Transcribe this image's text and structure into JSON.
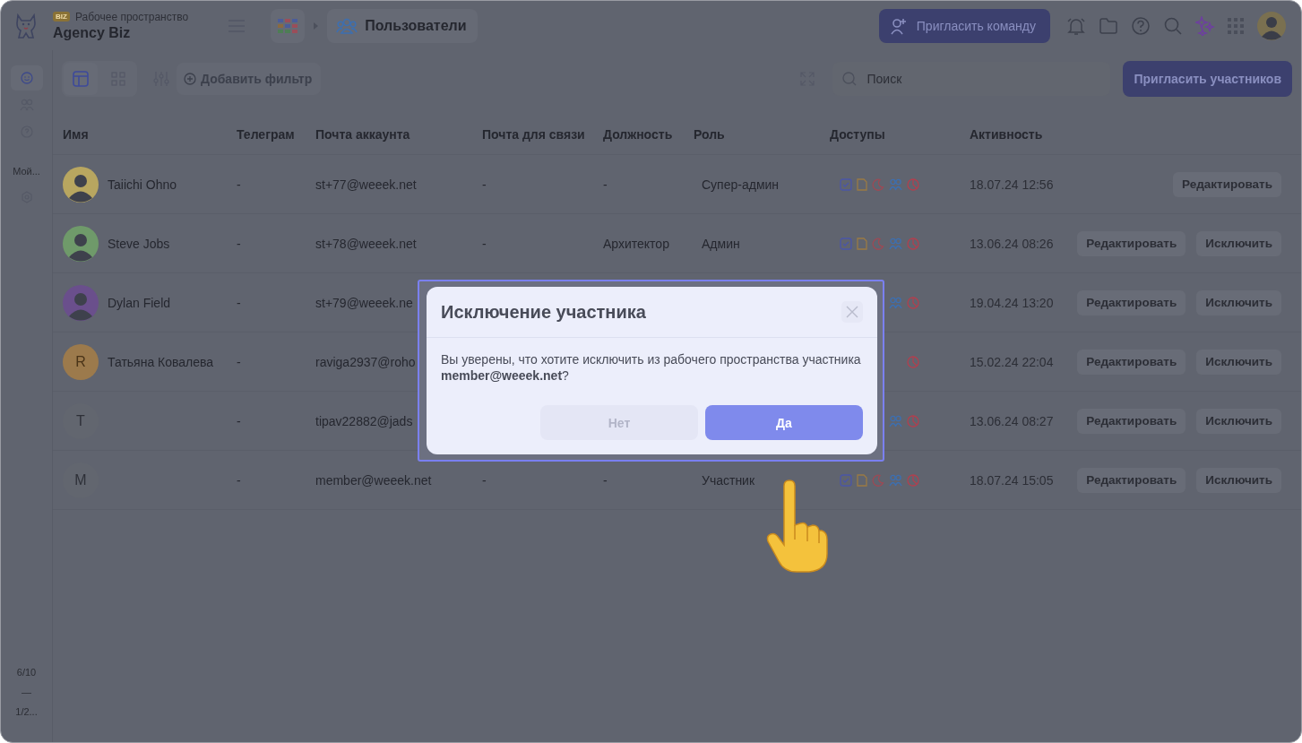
{
  "workspace": {
    "badge": "BIZ",
    "label": "Рабочее пространство",
    "name": "Agency Biz"
  },
  "breadcrumb": {
    "page": "Пользователи"
  },
  "header": {
    "invite_button": "Пригласить команду"
  },
  "sidebar": {
    "icons": [
      {
        "selected": true
      },
      {
        "selected": false
      },
      {
        "selected": false
      }
    ],
    "section_label": "Мой...",
    "footer": [
      "6/10",
      "—",
      "1/2..."
    ]
  },
  "toolbar": {
    "views": [
      {
        "selected": true
      },
      {
        "selected": false
      }
    ],
    "filter_button": "Добавить фильтр",
    "search_placeholder": "Поиск",
    "invite_button": "Пригласить участников"
  },
  "table": {
    "columns": [
      "Имя",
      "Телеграм",
      "Почта аккаунта",
      "Почта для связи",
      "Должность",
      "Роль",
      "Доступы",
      "Активность"
    ],
    "rows": [
      {
        "name": "Taiichi Ohno",
        "avatar": {
          "kind": "photo",
          "color": "#b8a660"
        },
        "telegram": "-",
        "account_email": "st+77@weeek.net",
        "contact_email": "-",
        "position": "-",
        "role": "Супер-админ",
        "access": [
          {
            "kind": "task"
          },
          {
            "kind": "doc"
          },
          {
            "kind": "moon"
          },
          {
            "kind": "people"
          },
          {
            "kind": "clock"
          }
        ],
        "activity": "18.07.24 12:56",
        "actions": [
          "Редактировать"
        ]
      },
      {
        "name": "Steve Jobs",
        "avatar": {
          "kind": "photo",
          "color": "#6f9a6a"
        },
        "telegram": "-",
        "account_email": "st+78@weeek.net",
        "contact_email": "-",
        "position": "Архитектор",
        "role": "Админ",
        "access": [
          {
            "kind": "task"
          },
          {
            "kind": "doc"
          },
          {
            "kind": "moon"
          },
          {
            "kind": "people"
          },
          {
            "kind": "clock"
          }
        ],
        "activity": "13.06.24 08:26",
        "actions": [
          "Редактировать",
          "Исключить"
        ]
      },
      {
        "name": "Dylan Field",
        "avatar": {
          "kind": "photo",
          "color": "#6a4f8c"
        },
        "telegram": "-",
        "account_email": "st+79@weeek.ne",
        "access": [
          {
            "kind": "people"
          },
          {
            "kind": "clock"
          }
        ],
        "activity": "19.04.24 13:20",
        "actions": [
          "Редактировать",
          "Исключить"
        ]
      },
      {
        "name": "Татьяна Ковалева",
        "avatar": {
          "kind": "letter",
          "letter": "R",
          "color": "#9c7a4c"
        },
        "telegram": "-",
        "account_email": "raviga2937@roho",
        "access": [
          {
            "kind": "clock"
          }
        ],
        "activity": "15.02.24 22:04",
        "actions": [
          "Редактировать",
          "Исключить"
        ]
      },
      {
        "avatar": {
          "kind": "letter",
          "letter": "T"
        },
        "telegram": "-",
        "account_email": "tipav22882@jads",
        "access": [
          {
            "kind": "people"
          },
          {
            "kind": "clock"
          }
        ],
        "activity": "13.06.24 08:27",
        "actions": [
          "Редактировать",
          "Исключить"
        ]
      },
      {
        "avatar": {
          "kind": "letter",
          "letter": "M"
        },
        "telegram": "-",
        "account_email": "member@weeek.net",
        "contact_email": "-",
        "position": "-",
        "role": "Участник",
        "access": [
          {
            "kind": "task"
          },
          {
            "kind": "doc"
          },
          {
            "kind": "moon"
          },
          {
            "kind": "people"
          },
          {
            "kind": "clock"
          }
        ],
        "activity": "18.07.24 15:05",
        "actions": [
          "Редактировать",
          "Исключить"
        ]
      }
    ]
  },
  "modal": {
    "title": "Исключение участника",
    "message": "Вы уверены, что хотите исключить из рабочего пространства участника **member@weeek.net**?",
    "buttons": [
      {
        "label": "Нет",
        "kind": "secondary"
      },
      {
        "label": "Да",
        "kind": "primary"
      }
    ]
  }
}
